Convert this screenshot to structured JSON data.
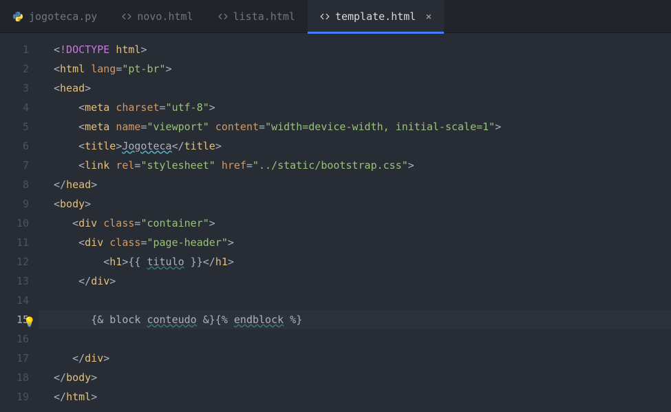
{
  "tabs": [
    {
      "label": "jogoteca.py",
      "icon": "python",
      "active": false
    },
    {
      "label": "novo.html",
      "icon": "html",
      "active": false
    },
    {
      "label": "lista.html",
      "icon": "html",
      "active": false
    },
    {
      "label": "template.html",
      "icon": "html",
      "active": true,
      "closeable": true
    }
  ],
  "active_line": 15,
  "gutter": {
    "start": 1,
    "end": 19
  },
  "code": {
    "1": [
      [
        "br",
        "<"
      ],
      [
        "kw",
        "!DOCTYPE "
      ],
      [
        "tg",
        "html"
      ],
      [
        "br",
        ">"
      ]
    ],
    "2": [
      [
        "br",
        "<"
      ],
      [
        "tg",
        "html "
      ],
      [
        "at",
        "lang"
      ],
      [
        "eq",
        "="
      ],
      [
        "st",
        "\"pt-br\""
      ],
      [
        "br",
        ">"
      ]
    ],
    "3": [
      [
        "br",
        "<"
      ],
      [
        "tg",
        "head"
      ],
      [
        "br",
        ">"
      ]
    ],
    "4": [
      [
        "p",
        "    "
      ],
      [
        "br",
        "<"
      ],
      [
        "tg",
        "meta "
      ],
      [
        "at",
        "charset"
      ],
      [
        "eq",
        "="
      ],
      [
        "st",
        "\"utf-8\""
      ],
      [
        "br",
        ">"
      ]
    ],
    "5": [
      [
        "p",
        "    "
      ],
      [
        "br",
        "<"
      ],
      [
        "tg",
        "meta "
      ],
      [
        "at",
        "name"
      ],
      [
        "eq",
        "="
      ],
      [
        "st",
        "\"viewport\""
      ],
      [
        "tg",
        " "
      ],
      [
        "at",
        "content"
      ],
      [
        "eq",
        "="
      ],
      [
        "st",
        "\"width=device-width, initial-scale=1\""
      ],
      [
        "br",
        ">"
      ]
    ],
    "6": [
      [
        "p",
        "    "
      ],
      [
        "br",
        "<"
      ],
      [
        "tg",
        "title"
      ],
      [
        "br",
        ">"
      ],
      [
        "tx",
        "",
        "wavy"
      ],
      [
        "tx",
        "Jogoteca",
        "wavy"
      ],
      [
        "br",
        "</"
      ],
      [
        "tg",
        "title"
      ],
      [
        "br",
        ">"
      ]
    ],
    "7": [
      [
        "p",
        "    "
      ],
      [
        "br",
        "<"
      ],
      [
        "tg",
        "link "
      ],
      [
        "at",
        "rel"
      ],
      [
        "eq",
        "="
      ],
      [
        "st",
        "\"stylesheet\""
      ],
      [
        "tg",
        " "
      ],
      [
        "at",
        "href"
      ],
      [
        "eq",
        "="
      ],
      [
        "st",
        "\"../static/bootstrap.css\""
      ],
      [
        "br",
        ">"
      ]
    ],
    "8": [
      [
        "br",
        "</"
      ],
      [
        "tg",
        "head"
      ],
      [
        "br",
        ">"
      ]
    ],
    "9": [
      [
        "br",
        "<"
      ],
      [
        "tg",
        "body"
      ],
      [
        "br",
        ">"
      ]
    ],
    "10": [
      [
        "p",
        "   "
      ],
      [
        "br",
        "<"
      ],
      [
        "tg",
        "div "
      ],
      [
        "at",
        "class"
      ],
      [
        "eq",
        "="
      ],
      [
        "st",
        "\"container\""
      ],
      [
        "br",
        ">"
      ]
    ],
    "11": [
      [
        "p",
        "    "
      ],
      [
        "br",
        "<"
      ],
      [
        "tg",
        "div "
      ],
      [
        "at",
        "class"
      ],
      [
        "eq",
        "="
      ],
      [
        "st",
        "\"page-header\""
      ],
      [
        "br",
        ">"
      ]
    ],
    "12": [
      [
        "p",
        "        "
      ],
      [
        "br",
        "<"
      ],
      [
        "tg",
        "h1"
      ],
      [
        "br",
        ">"
      ],
      [
        "tpl",
        "{{ "
      ],
      [
        "tx",
        "titulo",
        "wavy2"
      ],
      [
        "tpl",
        " }}"
      ],
      [
        "br",
        "</"
      ],
      [
        "tg",
        "h1"
      ],
      [
        "br",
        ">"
      ]
    ],
    "13": [
      [
        "p",
        "    "
      ],
      [
        "br",
        "</"
      ],
      [
        "tg",
        "div"
      ],
      [
        "br",
        ">"
      ]
    ],
    "14": [
      [
        "p",
        ""
      ]
    ],
    "15": [
      [
        "p",
        "      "
      ],
      [
        "tpl",
        "{& block "
      ],
      [
        "tx",
        "conteudo",
        "wavy2"
      ],
      [
        "tpl",
        " &}{% "
      ],
      [
        "tx",
        "endblock",
        "wavy2"
      ],
      [
        "tpl",
        " %}"
      ]
    ],
    "16": [
      [
        "p",
        ""
      ]
    ],
    "17": [
      [
        "p",
        "   "
      ],
      [
        "br",
        "</"
      ],
      [
        "tg",
        "div"
      ],
      [
        "br",
        ">"
      ]
    ],
    "18": [
      [
        "br",
        "</"
      ],
      [
        "tg",
        "body"
      ],
      [
        "br",
        ">"
      ]
    ],
    "19": [
      [
        "br",
        "</"
      ],
      [
        "tg",
        "html"
      ],
      [
        "br",
        ">"
      ]
    ]
  },
  "icons": {
    "python_colors": {
      "top": "#4584b6",
      "bottom": "#ffde57"
    },
    "close_glyph": "×"
  }
}
